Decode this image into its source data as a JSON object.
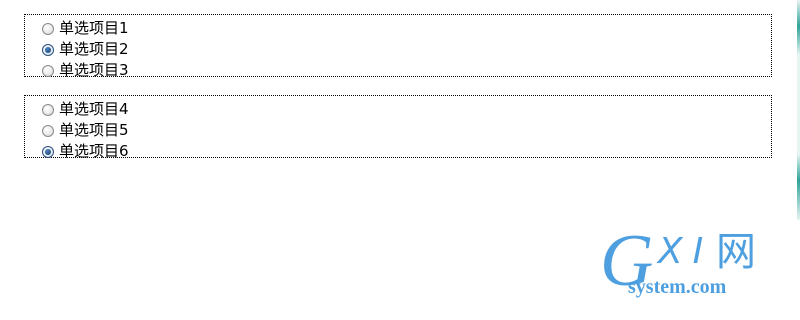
{
  "group1": {
    "options": [
      {
        "label": "单选项目1",
        "checked": false
      },
      {
        "label": "单选项目2",
        "checked": true
      },
      {
        "label": "单选项目3",
        "checked": false
      }
    ]
  },
  "group2": {
    "options": [
      {
        "label": "单选项目4",
        "checked": false
      },
      {
        "label": "单选项目5",
        "checked": false
      },
      {
        "label": "单选项目6",
        "checked": true
      }
    ]
  },
  "watermark": {
    "letter_g": "G",
    "letters_xi": "XI",
    "char_wang": "网",
    "domain": "system.com"
  },
  "colors": {
    "watermark": "#4d9fe0",
    "radio_checked": "#1b4576"
  }
}
